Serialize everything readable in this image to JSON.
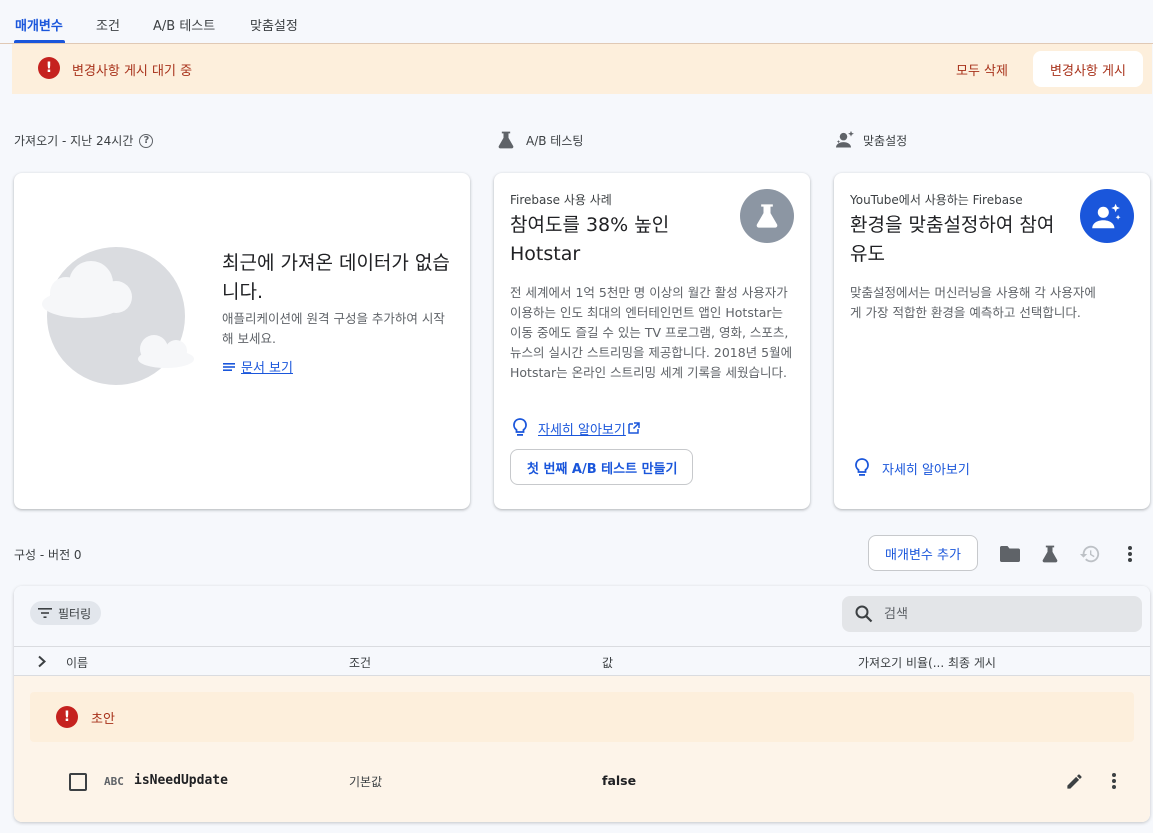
{
  "tabs": [
    {
      "label": "매개변수"
    },
    {
      "label": "조건"
    },
    {
      "label": "A/B 테스트"
    },
    {
      "label": "맞춤설정"
    }
  ],
  "banner": {
    "message": "변경사항 게시 대기 중",
    "discard_label": "모두 삭제",
    "publish_label": "변경사항 게시"
  },
  "sections": {
    "fetch": "가져오기 - 지난 24시간",
    "ab": "A/B 테스팅",
    "personalization": "맞춤설정"
  },
  "empty_card": {
    "title": "최근에 가져온 데이터가 없습니다.",
    "desc": "애플리케이션에 원격 구성을 추가하여 시작해 보세요.",
    "docs_link": "문서 보기"
  },
  "ab_card": {
    "eyebrow": "Firebase 사용 사례",
    "title": "참여도를 38% 높인 Hotstar",
    "body": "전 세계에서 1억 5천만 명 이상의 월간 활성 사용자가 이용하는 인도 최대의 엔터테인먼트 앱인 Hotstar는 이동 중에도 즐길 수 있는 TV 프로그램, 영화, 스포츠, 뉴스의 실시간 스트리밍을 제공합니다. 2018년 5월에 Hotstar는 온라인 스트리밍 세계 기록을 세웠습니다.",
    "learn_more": "자세히 알아보기",
    "create_button": "첫 번째 A/B 테스트 만들기"
  },
  "personalization_card": {
    "eyebrow": "YouTube에서 사용하는 Firebase",
    "title": "환경을 맞춤설정하여 참여 유도",
    "body": "맞춤설정에서는 머신러닝을 사용해 각 사용자에게 가장 적합한 환경을 예측하고 선택합니다.",
    "learn_more": "자세히 알아보기"
  },
  "config": {
    "version_label": "구성 - 버전 0",
    "add_param_button": "매개변수 추가"
  },
  "table": {
    "filter_label": "필터링",
    "search_placeholder": "검색",
    "columns": {
      "name": "이름",
      "condition": "조건",
      "value": "값",
      "fetch": "가져오기 비율(... 최종 게시"
    },
    "draft_label": "초안",
    "rows": [
      {
        "type": "ABC",
        "name": "isNeedUpdate",
        "condition": "기본값",
        "value": "false"
      }
    ]
  },
  "colors": {
    "accent": "#1a56db",
    "warning_text": "#a8321b",
    "warning_bg": "#fdefdc",
    "error_icon": "#c5221f"
  }
}
